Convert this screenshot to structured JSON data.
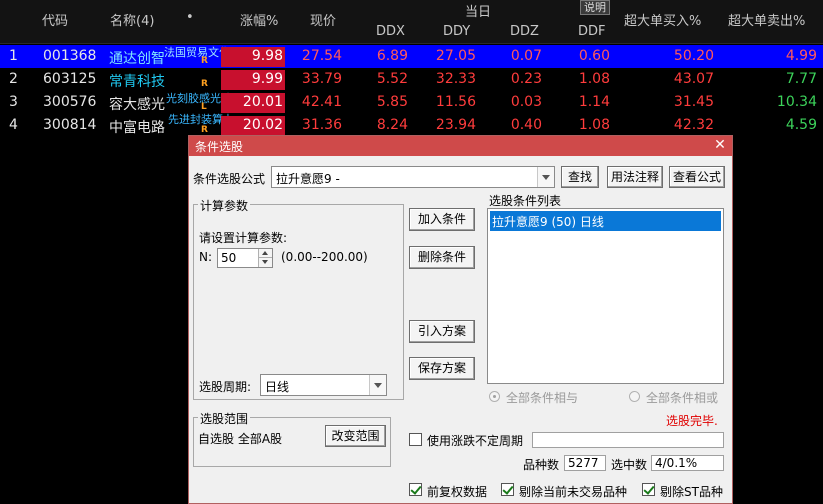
{
  "table": {
    "headers": {
      "code": "代码",
      "name": "名称(4)",
      "dot": "•",
      "change": "涨幅%",
      "price": "现价",
      "today": "当日",
      "ddx": "DDX",
      "ddy": "DDY",
      "ddz": "DDZ",
      "ddf": "DDF",
      "explain": "说明",
      "super_buy": "超大单买入%",
      "super_sell": "超大单卖出%"
    },
    "rows": [
      {
        "idx": "1",
        "code": "001368",
        "name": "通达创智",
        "ann": "法国贸易文化",
        "badge": "R",
        "chg": "9.98",
        "price": "27.54",
        "ddx": "6.89",
        "ddy": "27.05",
        "ddz": "0.07",
        "ddf": "0.60",
        "buy": "50.20",
        "sell": "4.99"
      },
      {
        "idx": "2",
        "code": "603125",
        "name": "常青科技",
        "ann": "",
        "badge": "R",
        "chg": "9.99",
        "price": "33.79",
        "ddx": "5.52",
        "ddy": "32.33",
        "ddz": "0.23",
        "ddf": "1.08",
        "buy": "43.07",
        "sell": "7.77"
      },
      {
        "idx": "3",
        "code": "300576",
        "name": "容大感光",
        "ann": "光刻胶感光油",
        "badge": "L",
        "chg": "20.01",
        "price": "42.41",
        "ddx": "5.85",
        "ddy": "11.56",
        "ddz": "0.03",
        "ddf": "1.14",
        "buy": "31.45",
        "sell": "10.34"
      },
      {
        "idx": "4",
        "code": "300814",
        "name": "中富电路",
        "ann": "先进封装算力",
        "badge": "R",
        "chg": "20.02",
        "price": "31.36",
        "ddx": "8.24",
        "ddy": "23.94",
        "ddz": "0.40",
        "ddf": "1.08",
        "buy": "42.32",
        "sell": "4.59"
      }
    ]
  },
  "dialog": {
    "title": "条件选股",
    "close": "✕",
    "formula_label": "条件选股公式",
    "formula_value": "拉升意愿9  -",
    "btn_find": "查找",
    "btn_usage": "用法注释",
    "btn_view": "查看公式",
    "calc_group": "计算参数",
    "calc_prompt": "请设置计算参数:",
    "param_name": "N:",
    "param_value": "50",
    "param_range": "(0.00--200.00)",
    "period_label": "选股周期:",
    "period_value": "日线",
    "btn_add": "加入条件",
    "btn_delete": "删除条件",
    "btn_import": "引入方案",
    "btn_save": "保存方案",
    "list_label": "选股条件列表",
    "list_items": [
      "拉升意愿9 (50) 日线"
    ],
    "radio_and": "全部条件相与",
    "radio_or": "全部条件相或",
    "status": "选股完毕.",
    "range_group": "选股范围",
    "range_value": "自选股 全部A股",
    "btn_change_range": "改变范围",
    "chk_period": "使用涨跌不定周期",
    "count_label": "品种数",
    "count_value": "5277",
    "selected_label": "选中数",
    "selected_value": "4/0.1%",
    "chk_adjusted": "前复权数据",
    "chk_exclude_untraded": "剔除当前未交易品种",
    "chk_exclude_st": "剔除ST品种"
  },
  "colors": {
    "selected_row": "#0000ff",
    "change_box": "#c8102e",
    "titlebar": "#cf4a4a",
    "up": "#ff3c3c",
    "down": "#3cd25a",
    "list_selection": "#0a78d7"
  }
}
